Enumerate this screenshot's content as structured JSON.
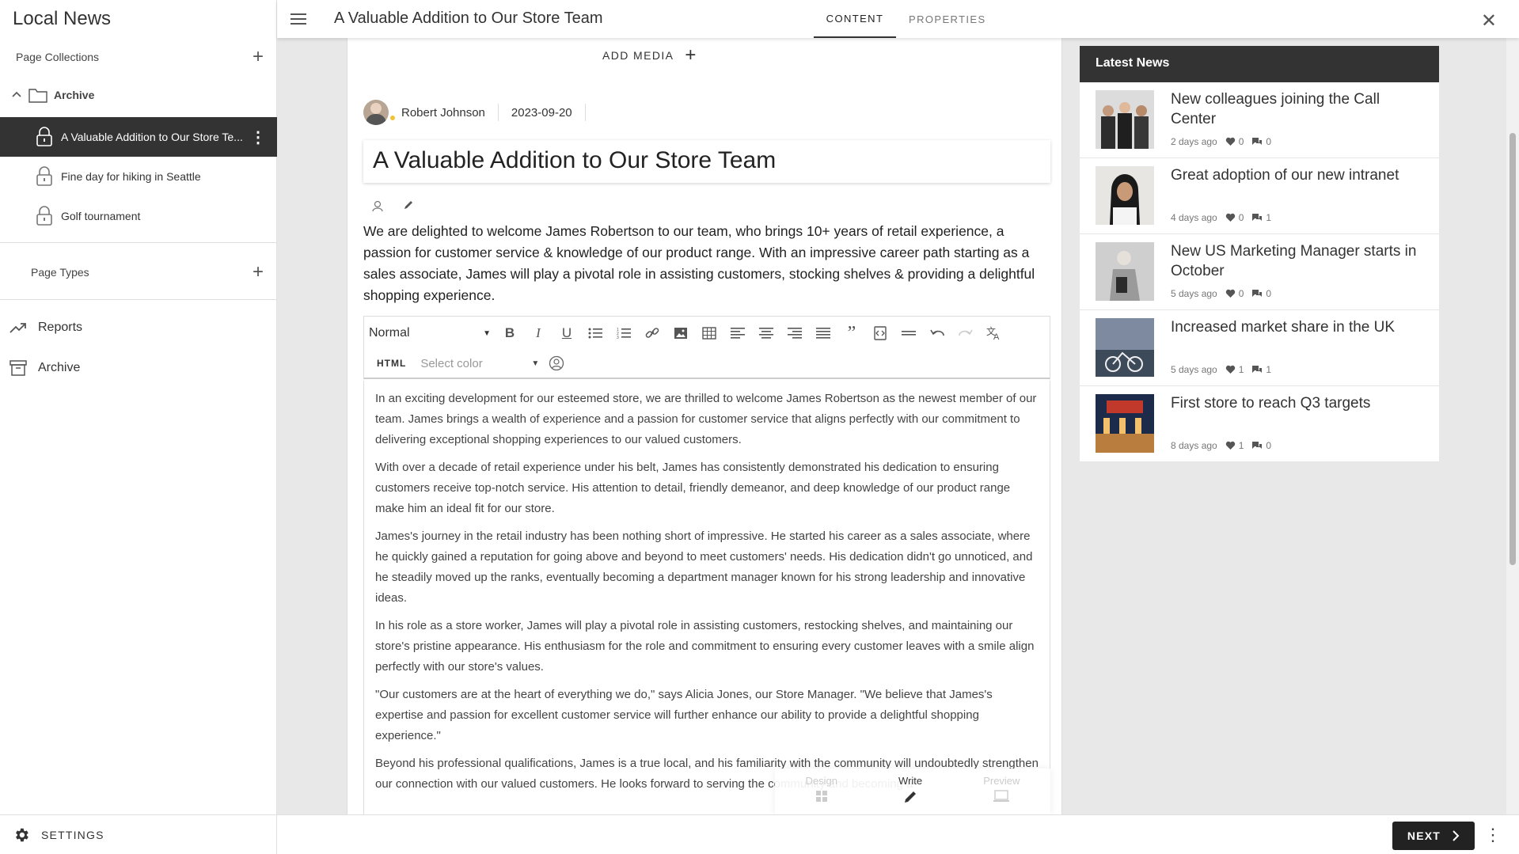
{
  "sidebar": {
    "app_title": "Local News",
    "page_collections_label": "Page Collections",
    "archive_folder_label": "Archive",
    "pages": [
      {
        "label": "A Valuable Addition to Our Store Te..."
      },
      {
        "label": "Fine day for hiking in Seattle"
      },
      {
        "label": "Golf tournament"
      }
    ],
    "page_types_label": "Page Types",
    "nav": [
      {
        "label": "Reports",
        "icon": "trending-up-icon"
      },
      {
        "label": "Archive",
        "icon": "archive-box-icon"
      }
    ],
    "settings_label": "SETTINGS"
  },
  "header": {
    "doc_title": "A Valuable Addition to Our Store Team",
    "tabs": [
      {
        "label": "CONTENT",
        "active": true
      },
      {
        "label": "PROPERTIES",
        "active": false
      }
    ]
  },
  "editor": {
    "add_media_label": "ADD MEDIA",
    "author": "Robert Johnson",
    "date": "2023-09-20",
    "title": "A Valuable Addition to Our Store Team",
    "lead": "We are delighted to welcome James Robertson to our team, who brings 10+ years of retail experience, a passion for customer service & knowledge of our product range. With an impressive career path starting as a sales associate, James will play a pivotal role in assisting customers, stocking shelves & providing a delightful shopping experience.",
    "toolbar": {
      "format_value": "Normal",
      "html_label": "HTML",
      "color_placeholder": "Select color"
    },
    "paragraphs": [
      "In an exciting development for our esteemed store, we are thrilled to welcome James Robertson as the newest member of our team. James brings a wealth of experience and a passion for customer service that aligns perfectly with our commitment to delivering exceptional shopping experiences to our valued customers.",
      "With over a decade of retail experience under his belt, James has consistently demonstrated his dedication to ensuring customers receive top-notch service. His attention to detail, friendly demeanor, and deep knowledge of our product range make him an ideal fit for our store.",
      "James's journey in the retail industry has been nothing short of impressive. He started his career as a sales associate, where he quickly gained a reputation for going above and beyond to meet customers' needs. His dedication didn't go unnoticed, and he steadily moved up the ranks, eventually becoming a department manager known for his strong leadership and innovative ideas.",
      "In his role as a store worker, James will play a pivotal role in assisting customers, restocking shelves, and maintaining our store's pristine appearance. His enthusiasm for the role and commitment to ensuring every customer leaves with a smile align perfectly with our store's values.",
      "\"Our customers are at the heart of everything we do,\" says Alicia Jones, our Store Manager. \"We believe that James's expertise and passion for excellent customer service will further enhance our ability to provide a delightful shopping experience.\"",
      "Beyond his professional qualifications, James is a true local, and his familiarity with the community will undoubtedly strengthen our connection with our valued customers. He looks forward to serving the community and becoming a"
    ],
    "modes": [
      {
        "label": "Design",
        "active": false
      },
      {
        "label": "Write",
        "active": true
      },
      {
        "label": "Preview",
        "active": false
      }
    ]
  },
  "latest_news": {
    "header": "Latest News",
    "items": [
      {
        "title": "New colleagues joining the Call Center",
        "age": "2 days ago",
        "likes": "0",
        "comments": "0"
      },
      {
        "title": "Great adoption of our new intranet",
        "age": "4 days ago",
        "likes": "0",
        "comments": "1"
      },
      {
        "title": "New US Marketing Manager starts in October",
        "age": "5 days ago",
        "likes": "0",
        "comments": "0"
      },
      {
        "title": "Increased market share in the UK",
        "age": "5 days ago",
        "likes": "1",
        "comments": "1"
      },
      {
        "title": "First store to reach Q3 targets",
        "age": "8 days ago",
        "likes": "1",
        "comments": "0"
      }
    ]
  },
  "footer": {
    "next_label": "NEXT"
  },
  "colors": {
    "dark": "#333333",
    "presence": "#f1c232",
    "canvas_bg": "#e8e8e8"
  }
}
